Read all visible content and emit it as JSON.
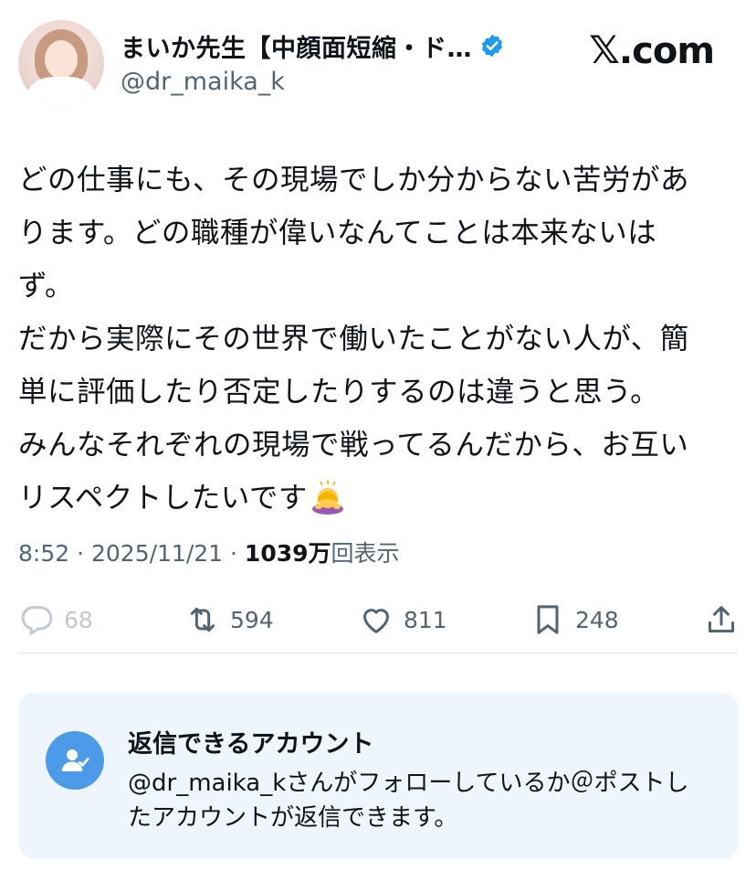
{
  "header": {
    "display_name": "まいか先生【中顔面短縮・ド…",
    "handle": "@dr_maika_k",
    "brand": "com",
    "brand_mark": "𝕏"
  },
  "tweet": {
    "lines": [
      "どの仕事にも、その現場でしか分からない苦労があ",
      "ります。どの職種が偉いなんてことは本来ないは",
      "ず。",
      "だから実際にその世界で働いたことがない人が、簡",
      "単に評価したり否定したりするのは違うと思う。",
      "みんなそれぞれの現場で戦ってるんだから、お互い",
      "リスペクトしたいです"
    ],
    "emoji": "bowing-woman-emoji"
  },
  "meta": {
    "time": "8:52",
    "sep1": " · ",
    "date": "2025/11/21",
    "sep2": " · ",
    "views": "1039万",
    "views_suffix": "回表示"
  },
  "actions": {
    "replies": "68",
    "reposts": "594",
    "likes": "811",
    "bookmarks": "248"
  },
  "reply_restriction": {
    "title": "返信できるアカウント",
    "description": "@dr_maika_kさんがフォローしているか＠ポストしたアカウントが返信できます。"
  },
  "colors": {
    "text": "#0f1419",
    "secondary": "#536471",
    "verified": "#1d9bf0",
    "card_bg": "#eef5fc",
    "icon_bg": "#4c9ae8"
  }
}
